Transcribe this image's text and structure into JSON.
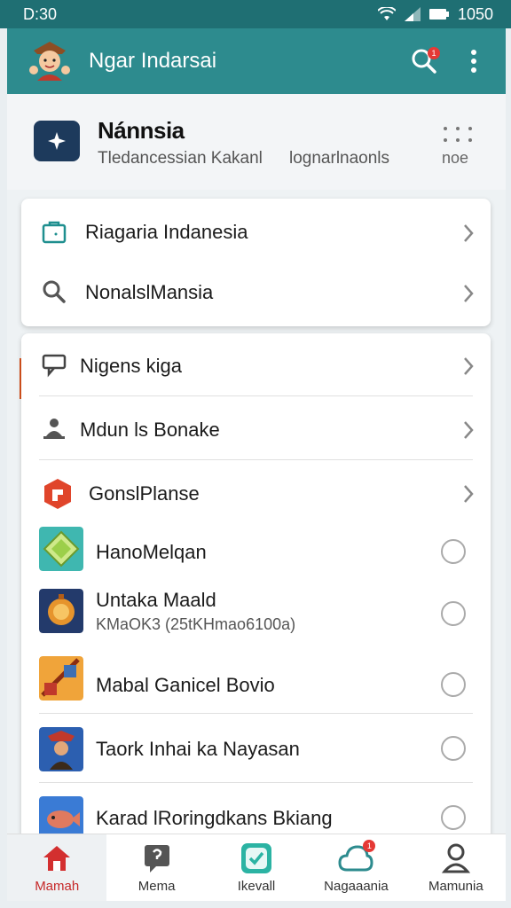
{
  "status_bar": {
    "time": "D:30",
    "clock_right": "1050",
    "icons": [
      "wifi-icon",
      "signal-icon",
      "battery-icon"
    ]
  },
  "app_bar": {
    "title": "Ngar Indarsai",
    "search_badge": "1",
    "icons": [
      "mascot-icon",
      "search-icon",
      "more-vert-icon"
    ]
  },
  "profile": {
    "name": "Nánnsia",
    "subtitle": "Tledancessian Kakanl",
    "subtitle_right": "lognarlnaonls",
    "grid_label": "noe",
    "icons": [
      "app-logo-icon",
      "grid-dots-icon"
    ]
  },
  "menu_primary": [
    {
      "label": "Riagaria Indanesia",
      "icon": "bag-icon"
    },
    {
      "label": "NonalslMansia",
      "icon": "search-icon"
    }
  ],
  "menu_secondary": [
    {
      "label": "Nigens kiga",
      "icon": "chat-icon"
    },
    {
      "label": "Mdun ls Bonake",
      "icon": "user-stand-icon"
    },
    {
      "label": "GonslPlanse",
      "icon": "game-icon"
    }
  ],
  "app_list": [
    {
      "label": "HanoMelqan",
      "sublabel": "",
      "icon": "diamond-app-icon"
    },
    {
      "label": "Untaka Maald",
      "sublabel": "KMaOK3 (25tKHmao6100a)",
      "icon": "bell-app-icon"
    },
    {
      "label": "Mabal Ganicel Bovio",
      "sublabel": "",
      "icon": "battle-app-icon"
    },
    {
      "label": "Taork Inhai ka Nayasan",
      "sublabel": "",
      "icon": "warrior-app-icon"
    },
    {
      "label": "Karad lRoringdkans Bkiang",
      "sublabel": "",
      "icon": "fish-app-icon"
    }
  ],
  "bottom_nav": [
    {
      "label": "Mamah",
      "icon": "home-icon",
      "active": true
    },
    {
      "label": "Mema",
      "icon": "chat-bubble-icon",
      "active": false
    },
    {
      "label": "Ikevall",
      "icon": "check-app-icon",
      "active": false
    },
    {
      "label": "Nagaaania",
      "icon": "cloud-icon",
      "active": false,
      "badge": "1"
    },
    {
      "label": "Mamunia",
      "icon": "person-icon",
      "active": false
    }
  ],
  "colors": {
    "app_bar": "#2d8b8e",
    "status_bar": "#1f6f73",
    "active_nav": "#c62828",
    "accent": "#d9531e"
  }
}
